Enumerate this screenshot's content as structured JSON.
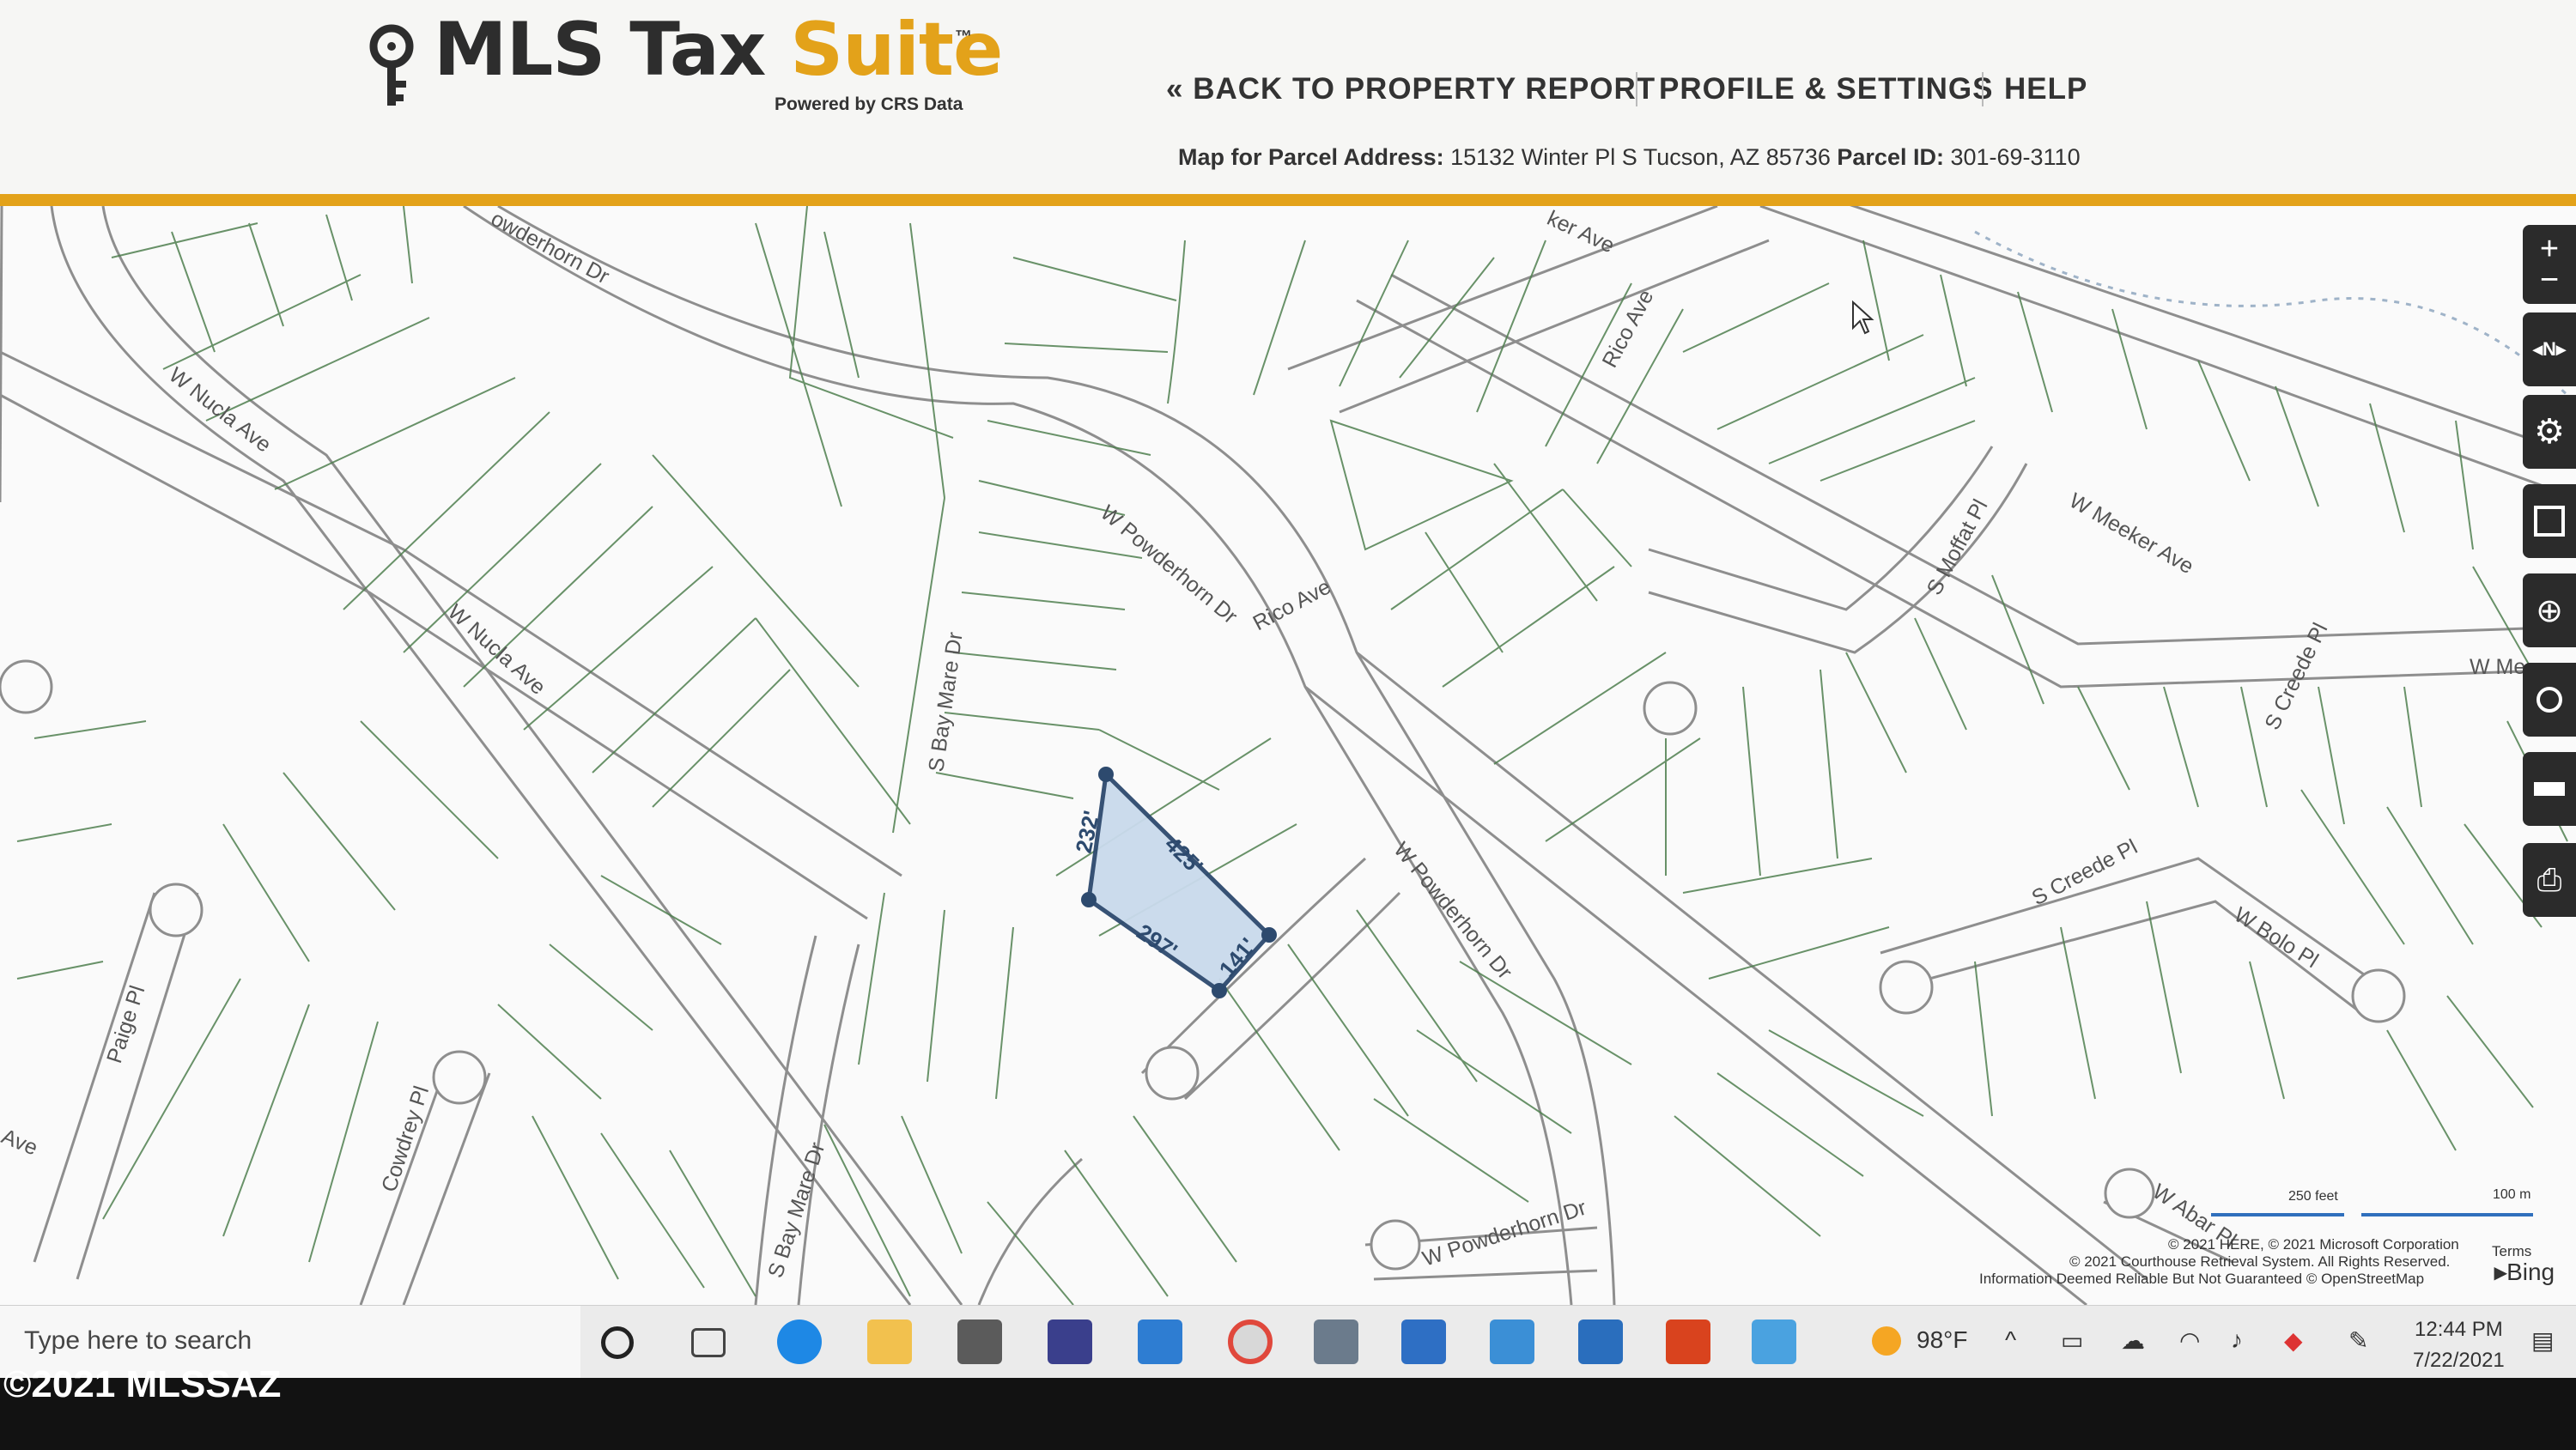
{
  "header": {
    "logo_main": "MLS Tax ",
    "logo_accent": "Suite",
    "logo_tm": "™",
    "powered_by": "Powered by CRS Data",
    "nav": {
      "back": "« BACK TO PROPERTY REPORT",
      "profile": "PROFILE & SETTINGS",
      "help": "HELP"
    },
    "parcel": {
      "address_label": "Map for Parcel Address:",
      "address_value": "15132 Winter Pl S Tucson, AZ 85736",
      "id_label": "Parcel ID:",
      "id_value": "301-69-3110"
    },
    "accent_color": "#e3a21a"
  },
  "map": {
    "streets": {
      "powderhorn_top": "owderhorn Dr",
      "meeker_top": "ker Ave",
      "rico_ave_vertical": "Rico Ave",
      "nucla_upper": "W Nucla Ave",
      "nucla_lower": "W Nucla Ave",
      "powderhorn_mid": "W Powderhorn Dr",
      "rico_ave_mid": "Rico Ave",
      "moffat": "S Moffat Pl",
      "meeker_right": "W Meeker Ave",
      "meeker_edge": "W Me",
      "creede_pl_vertical": "S Creede Pl",
      "bay_mare_upper": "S Bay Mare Dr",
      "powderhorn_right": "W Powderhorn Dr",
      "creede_pl_lower": "S Creede Pl",
      "bolo": "W Bolo Pl",
      "paige": "Paige Pl",
      "cowdrey": "Cowdrey Pl",
      "ave_left": "Ave",
      "bay_mare_lower": "S Bay Mare Dr",
      "powderhorn_bottom": "W Powderhorn Dr",
      "abar": "W Abar Pl"
    },
    "parcel_dimensions": {
      "left": "232'",
      "top": "425'",
      "bottom": "297'",
      "right": "141'"
    },
    "scale": {
      "feet": "250 feet",
      "meters": "100 m"
    },
    "attribution": {
      "line1": "© 2021 HERE, © 2021 Microsoft Corporation",
      "line2": "© 2021 Courthouse Retrieval System. All Rights Reserved.",
      "line3": "Information Deemed Reliable But Not Guaranteed © OpenStreetMap",
      "terms": "Terms",
      "bing": "Bing"
    },
    "parcel_fill": "#c9daec",
    "parcel_stroke": "#2d4a6e"
  },
  "toolbar": {
    "tools": [
      "zoom-in-icon",
      "compass-icon",
      "settings-icon",
      "select-area-icon",
      "locate-icon",
      "search-icon",
      "ruler-icon",
      "print-icon"
    ],
    "compass_letter": "N"
  },
  "taskbar": {
    "search_placeholder": "Type here to search",
    "weather": "98°F",
    "time": "12:44 PM",
    "date": "7/22/2021"
  },
  "watermark": "©2021 MLSSAZ"
}
